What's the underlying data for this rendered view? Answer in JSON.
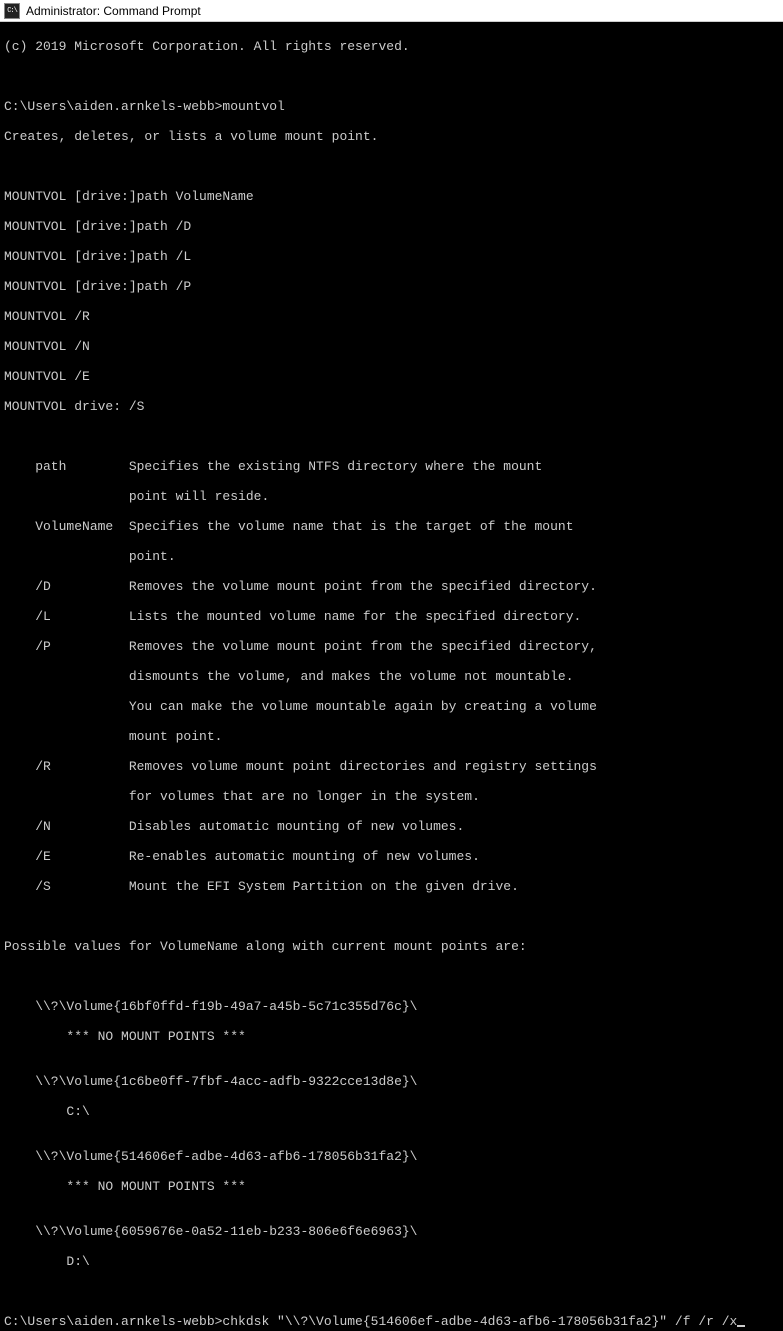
{
  "titlebar": {
    "icon_text": "C:\\",
    "title": "Administrator: Command Prompt"
  },
  "terminal": {
    "copyright": "(c) 2019 Microsoft Corporation. All rights reserved.",
    "prompt1": "C:\\Users\\aiden.arnkels-webb>mountvol",
    "description": "Creates, deletes, or lists a volume mount point.",
    "syntax": [
      "MOUNTVOL [drive:]path VolumeName",
      "MOUNTVOL [drive:]path /D",
      "MOUNTVOL [drive:]path /L",
      "MOUNTVOL [drive:]path /P",
      "MOUNTVOL /R",
      "MOUNTVOL /N",
      "MOUNTVOL /E",
      "MOUNTVOL drive: /S"
    ],
    "params": [
      "    path        Specifies the existing NTFS directory where the mount",
      "                point will reside.",
      "    VolumeName  Specifies the volume name that is the target of the mount",
      "                point.",
      "    /D          Removes the volume mount point from the specified directory.",
      "    /L          Lists the mounted volume name for the specified directory.",
      "    /P          Removes the volume mount point from the specified directory,",
      "                dismounts the volume, and makes the volume not mountable.",
      "                You can make the volume mountable again by creating a volume",
      "                mount point.",
      "    /R          Removes volume mount point directories and registry settings",
      "                for volumes that are no longer in the system.",
      "    /N          Disables automatic mounting of new volumes.",
      "    /E          Re-enables automatic mounting of new volumes.",
      "    /S          Mount the EFI System Partition on the given drive."
    ],
    "possible_header": "Possible values for VolumeName along with current mount points are:",
    "volumes": [
      "    \\\\?\\Volume{16bf0ffd-f19b-49a7-a45b-5c71c355d76c}\\",
      "        *** NO MOUNT POINTS ***",
      "",
      "    \\\\?\\Volume{1c6be0ff-7fbf-4acc-adfb-9322cce13d8e}\\",
      "        C:\\",
      "",
      "    \\\\?\\Volume{514606ef-adbe-4d63-afb6-178056b31fa2}\\",
      "        *** NO MOUNT POINTS ***",
      "",
      "    \\\\?\\Volume{6059676e-0a52-11eb-b233-806e6f6e6963}\\",
      "        D:\\"
    ],
    "prompt2": "C:\\Users\\aiden.arnkels-webb>chkdsk \"\\\\?\\Volume{514606ef-adbe-4d63-afb6-178056b31fa2}\" /f /r /x"
  }
}
